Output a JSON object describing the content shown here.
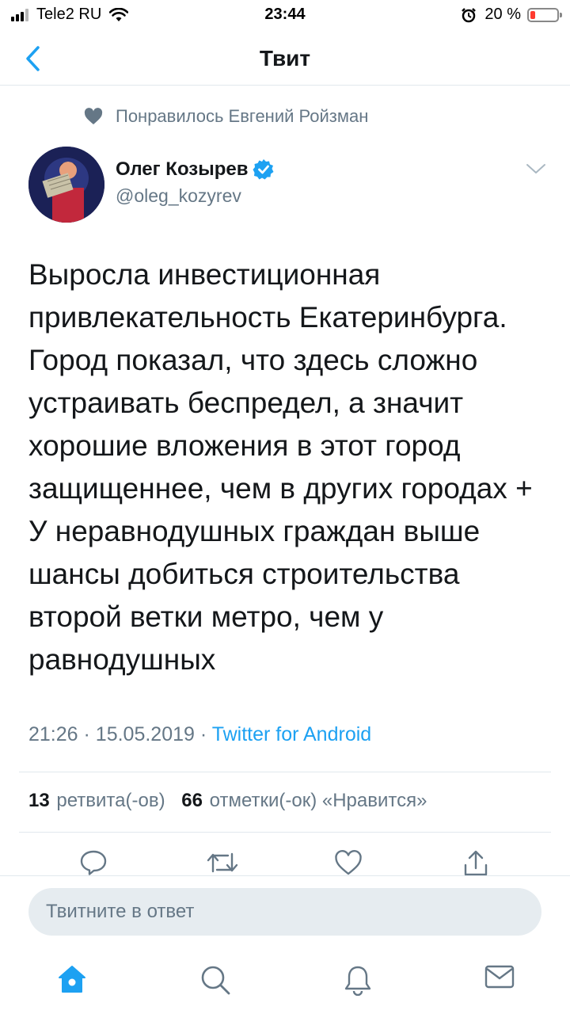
{
  "status_bar": {
    "carrier": "Tele2 RU",
    "time": "23:44",
    "battery_percent_text": "20 %",
    "battery_level": 0.2
  },
  "nav": {
    "title": "Твит",
    "back_icon": "chevron-left-icon"
  },
  "social_context": {
    "text": "Понравилось Евгений Ройзман",
    "icon": "heart-icon"
  },
  "author": {
    "name": "Олег Козырев",
    "handle": "@oleg_kozyrev",
    "verified": true
  },
  "tweet": {
    "lines": [
      "Выросла инвестиционная",
      "привлекательность Екатеринбурга.",
      "Город показал, что здесь сложно",
      "устраивать беспредел, а значит",
      "хорошие вложения в этот город",
      "защищеннее, чем в других городах +",
      "У неравнодушных граждан выше",
      "шансы добиться строительства",
      "второй ветки метро, чем у",
      "равнодушных"
    ],
    "time": "21:26",
    "date": "15.05.2019",
    "separator": "·",
    "source": "Twitter for Android"
  },
  "stats": {
    "retweets_count": "13",
    "retweets_label": "ретвита(-ов)",
    "likes_count": "66",
    "likes_label": "отметки(-ок) «Нравится»"
  },
  "actions": [
    "reply-icon",
    "retweet-icon",
    "like-icon",
    "share-icon"
  ],
  "reply": {
    "placeholder": "Твитните в ответ"
  },
  "tabbar": [
    "home-icon",
    "search-icon",
    "notifications-icon",
    "messages-icon"
  ],
  "colors": {
    "accent": "#1da1f2",
    "secondary_text": "#657786",
    "primary_text": "#14171a",
    "divider": "#e1e8ed",
    "reply_bg": "#e6ecf0",
    "battery_low": "#ff3b30"
  }
}
